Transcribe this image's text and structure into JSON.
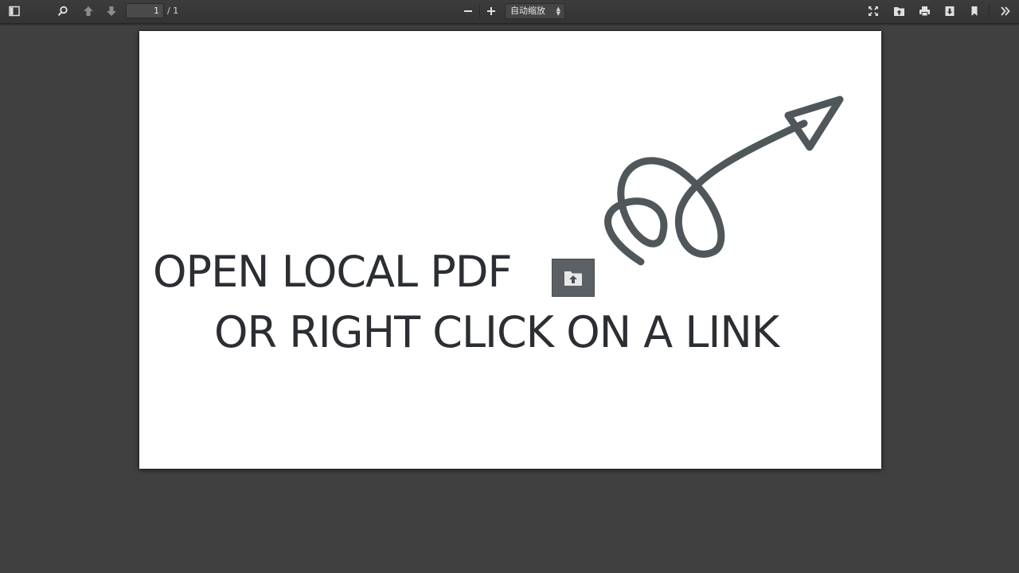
{
  "toolbar": {
    "sidebar_toggle_icon": "sidebar-icon",
    "search_icon": "search-icon",
    "prev_icon": "arrow-up-icon",
    "next_icon": "arrow-down-icon",
    "page_number": "1",
    "page_count": "/ 1",
    "zoom_out_icon": "minus-icon",
    "zoom_in_icon": "plus-icon",
    "zoom_value": "自动缩放",
    "right_icons": [
      "fullscreen-icon",
      "open-file-icon",
      "print-icon",
      "download-icon",
      "bookmark-icon",
      "more-tools-icon"
    ]
  },
  "document": {
    "line1": "OPEN LOCAL PDF",
    "line2": "OR RIGHT CLICK ON A LINK"
  },
  "colors": {
    "toolbar_bg": "#383838",
    "viewer_bg": "#404040",
    "page_bg": "#ffffff",
    "text": "#2b2e32",
    "arrow": "#50575b"
  }
}
